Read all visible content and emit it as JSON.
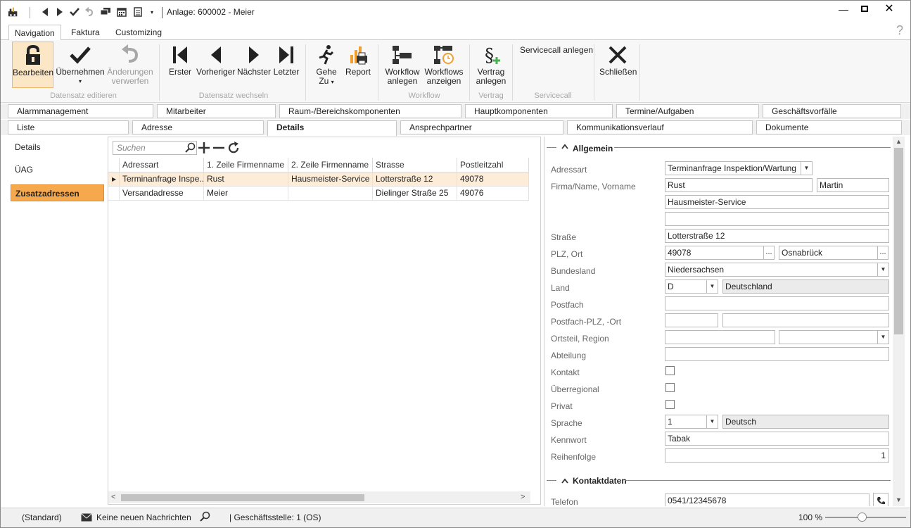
{
  "title": "Anlage: 600002 - Meier",
  "ribbon_tabs": [
    "Navigation",
    "Faktura",
    "Customizing"
  ],
  "ribbon": {
    "bearbeiten": "Bearbeiten",
    "uebernehmen": "Übernehmen",
    "aenderungen_1": "Änderungen",
    "aenderungen_2": "verwerfen",
    "grp_datensatz_edit": "Datensatz editieren",
    "erster": "Erster",
    "vorheriger": "Vorheriger",
    "naechster": "Nächster",
    "letzter": "Letzter",
    "grp_datensatz_wechsel": "Datensatz wechseln",
    "gehe_1": "Gehe",
    "gehe_2": "Zu",
    "report": "Report",
    "wf_anlegen_1": "Workflow",
    "wf_anlegen_2": "anlegen",
    "wf_anzeigen_1": "Workflows",
    "wf_anzeigen_2": "anzeigen",
    "grp_workflow": "Workflow",
    "vertrag_1": "Vertrag",
    "vertrag_2": "anlegen",
    "grp_vertrag": "Vertrag",
    "servicecall_anlegen": "Servicecall anlegen",
    "grp_servicecall": "Servicecall",
    "schliessen": "Schließen"
  },
  "tabs_row1": [
    "Alarmmanagement",
    "Mitarbeiter",
    "Raum-/Bereichskomponenten",
    "Hauptkomponenten",
    "Termine/Aufgaben",
    "Geschäftsvorfälle"
  ],
  "tabs_row2": [
    "Liste",
    "Adresse",
    "Details",
    "Ansprechpartner",
    "Kommunikationsverlauf",
    "Dokumente"
  ],
  "left_nav": [
    "Details",
    "ÜAG",
    "Zusatzadressen"
  ],
  "grid": {
    "search_placeholder": "Suchen",
    "columns": [
      "Adressart",
      "1. Zeile Firmenname",
      "2. Zeile Firmenname",
      "Strasse",
      "Postleitzahl"
    ],
    "rows": [
      [
        "Terminanfrage Inspe...",
        "Rust",
        "Hausmeister-Service",
        "Lotterstraße 12",
        "49078"
      ],
      [
        "Versandadresse",
        "Meier",
        "",
        "Dielinger Straße 25",
        "49076"
      ]
    ]
  },
  "form": {
    "section_allgemein": "Allgemein",
    "labels": {
      "adressart": "Adressart",
      "firma": "Firma/Name, Vorname",
      "strasse": "Straße",
      "plz_ort": "PLZ, Ort",
      "bundesland": "Bundesland",
      "land": "Land",
      "postfach": "Postfach",
      "postfach_plz": "Postfach-PLZ, -Ort",
      "ortsteil": "Ortsteil, Region",
      "abteilung": "Abteilung",
      "kontakt": "Kontakt",
      "ueberregional": "Überregional",
      "privat": "Privat",
      "sprache": "Sprache",
      "kennwort": "Kennwort",
      "reihenfolge": "Reihenfolge",
      "telefon": "Telefon"
    },
    "values": {
      "adressart": "Terminanfrage Inspektion/Wartung",
      "name": "Rust",
      "vorname": "Martin",
      "firma2": "Hausmeister-Service",
      "strasse": "Lotterstraße 12",
      "plz": "49078",
      "ort": "Osnabrück",
      "bundesland": "Niedersachsen",
      "land_code": "D",
      "land_name": "Deutschland",
      "sprache_code": "1",
      "sprache_name": "Deutsch",
      "kennwort": "Tabak",
      "reihenfolge": "1",
      "telefon": "0541/12345678"
    },
    "section_kontaktdaten": "Kontaktdaten",
    "dots": "..."
  },
  "status": {
    "standard": "(Standard)",
    "nachrichten": "Keine neuen Nachrichten",
    "geschaeftsstelle": "| Geschäftsstelle:  1 (OS)",
    "zoom": "100 %"
  }
}
